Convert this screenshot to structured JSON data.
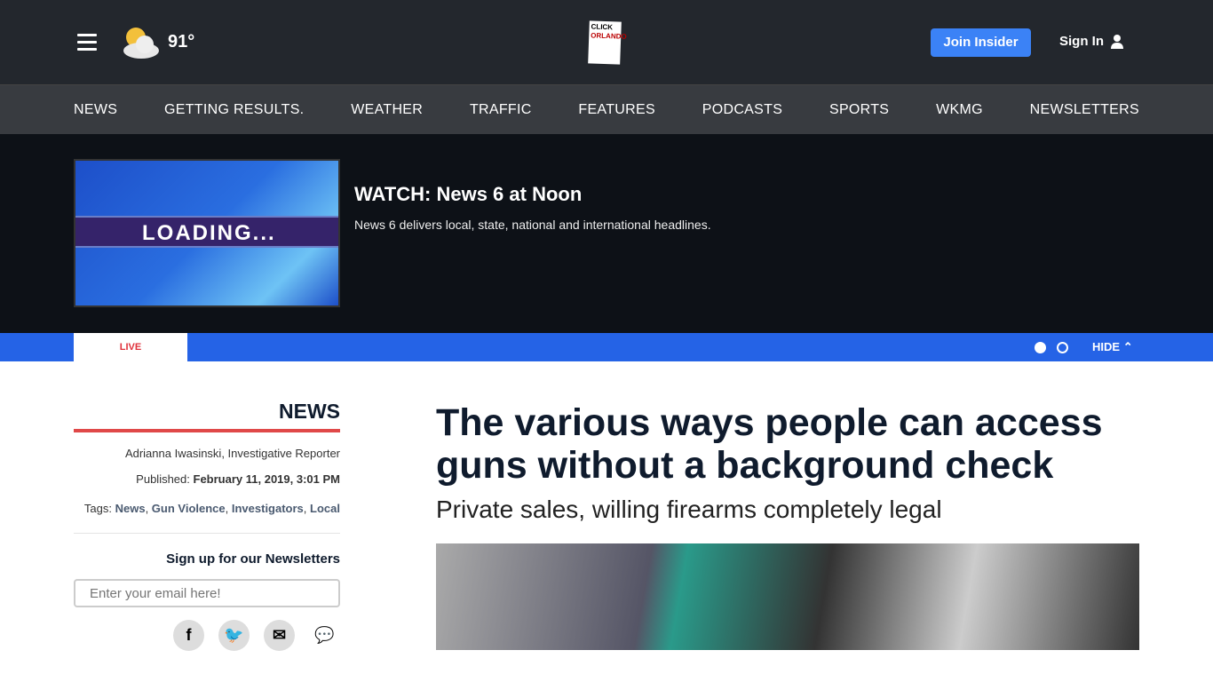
{
  "header": {
    "temperature": "91°",
    "weather_icon": "partly-cloudy",
    "logo_text": [
      "CLICK",
      "ORLANDO"
    ],
    "join_label": "Join Insider",
    "sign_in_label": "Sign In"
  },
  "nav": [
    "NEWS",
    "GETTING RESULTS.",
    "WEATHER",
    "TRAFFIC",
    "FEATURES",
    "PODCASTS",
    "SPORTS",
    "WKMG",
    "NEWSLETTERS"
  ],
  "video": {
    "thumb_text": "LOADING...",
    "title": "WATCH: News 6 at Noon",
    "description": "News 6 delivers local, state, national and international headlines."
  },
  "live_bar": {
    "live_label": "LIVE",
    "hide_label": "HIDE"
  },
  "sidebar": {
    "section": "NEWS",
    "author": "Adrianna Iwasinski, Investigative Reporter",
    "published_label": "Published:",
    "published_date": "February 11, 2019, 3:01 PM",
    "tags_label": "Tags:",
    "tags": [
      "News",
      "Gun Violence",
      "Investigators",
      "Local"
    ],
    "newsletter_title": "Sign up for our Newsletters",
    "email_placeholder": "Enter your email here!"
  },
  "article": {
    "title": "The various ways people can access guns without a background check",
    "subtitle": "Private sales, willing firearms completely legal"
  },
  "colors": {
    "accent": "#2563e6",
    "section_rule": "#e04848",
    "header": "#23272d"
  }
}
